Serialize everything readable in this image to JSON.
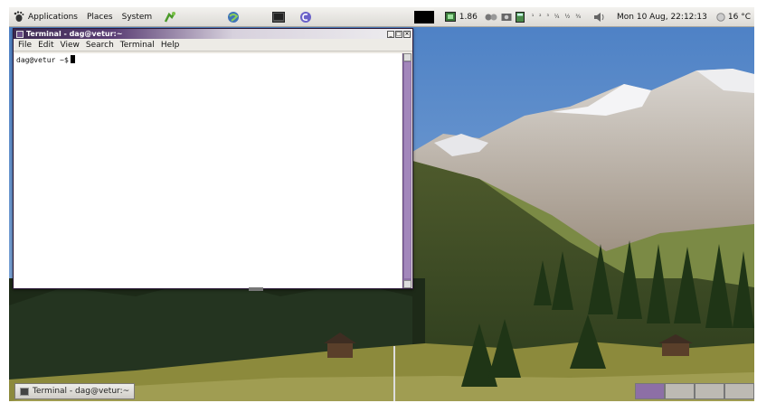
{
  "panel": {
    "menus": [
      "Applications",
      "Places",
      "System"
    ],
    "launchers": [
      "gimp-icon",
      "web-browser-icon",
      "terminal-launcher-icon",
      "debian-icon"
    ],
    "tray": {
      "load": "1.86",
      "notes": "¹ ² ³ ¼ ½ ¾",
      "clock": "Mon 10 Aug, 22:12:13",
      "temperature": "16 °C"
    }
  },
  "terminal": {
    "title": "Terminal - dag@vetur:~",
    "menu": [
      "File",
      "Edit",
      "View",
      "Search",
      "Terminal",
      "Help"
    ],
    "prompt": "dag@vetur ~$"
  },
  "taskbar": {
    "task_label": "Terminal - dag@vetur:~",
    "workspaces": 4,
    "active_workspace": 1
  },
  "colors": {
    "accent": "#5b3f75",
    "scrollbar": "#8d6fa6",
    "panel": "#e8e6e1"
  }
}
